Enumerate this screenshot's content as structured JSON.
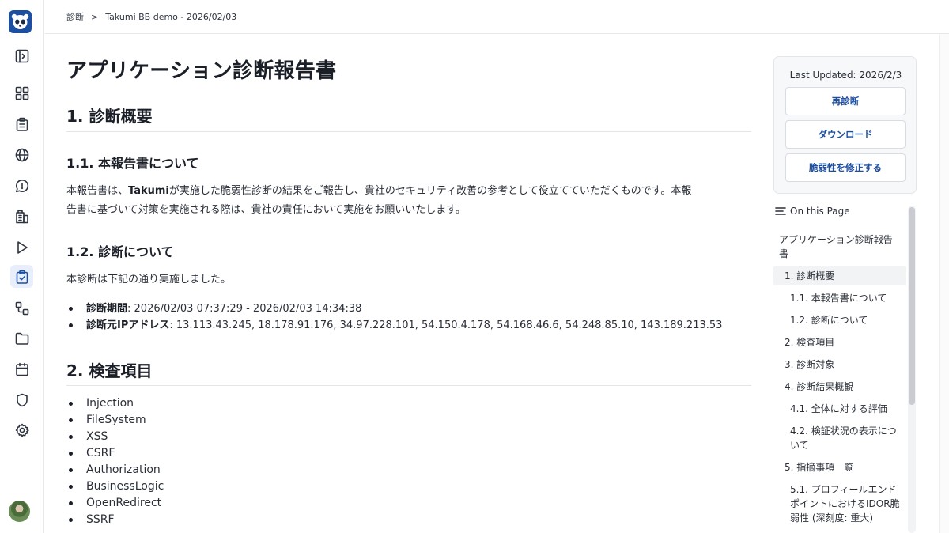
{
  "breadcrumb": {
    "root": "診断",
    "separator": ">",
    "current": "Takumi BB demo - 2026/02/03"
  },
  "sidebar": {
    "icons": [
      "logo-icon",
      "sidebar-toggle-icon",
      "dashboard-icon",
      "clipboard-list-icon",
      "globe-icon",
      "chat-icon",
      "building-icon",
      "play-icon",
      "clipboard-check-icon",
      "workflow-icon",
      "folder-icon",
      "calendar-icon",
      "shield-icon",
      "gear-icon"
    ],
    "active": "clipboard-check-icon"
  },
  "report": {
    "title": "アプリケーション診断報告書",
    "s1": "1. 診断概要",
    "s1_1": "1.1. 本報告書について",
    "s1_1_text_pre": "本報告書は、",
    "s1_1_text_bold": "Takumi",
    "s1_1_text_line1": "が実施した脆弱性診断の結果をご報告し、貴社のセキュリティ改善の参考として役立てていただくものです。本報",
    "s1_1_text_line2": "告書に基づいて対策を実施される際は、貴社の責任において実施をお願いいたします。",
    "s1_2": "1.2. 診断について",
    "s1_2_text": "本診断は下記の通り実施しました。",
    "period_label": "診断期間",
    "period_value": ": 2026/02/03 07:37:29 - 2026/02/03 14:34:38",
    "ip_label": "診断元IPアドレス",
    "ip_value": ": 13.113.43.245, 18.178.91.176, 34.97.228.101, 54.150.4.178, 54.168.46.6, 54.248.85.10, 143.189.213.53",
    "s2": "2. 検査項目",
    "checks": [
      "Injection",
      "FileSystem",
      "XSS",
      "CSRF",
      "Authorization",
      "BusinessLogic",
      "OpenRedirect",
      "SSRF"
    ]
  },
  "actions": {
    "last_updated": "Last Updated: 2026/2/3",
    "rediagnose": "再診断",
    "download": "ダウンロード",
    "fix": "脆弱性を修正する"
  },
  "toc": {
    "heading": "On this Page",
    "items": [
      "アプリケーション診断報告",
      "書",
      "1. 診断概要",
      "1.1. 本報告書について",
      "1.2. 診断について",
      "2. 検査項目",
      "3. 診断対象",
      "4. 診断結果概観",
      "4.1. 全体に対する評価",
      "4.2. 検証状況の表示につ",
      "いて",
      "5. 指摘事項一覧",
      "5.1. プロフィールエンド",
      "ポイントにおけるIDOR脆",
      "弱性 (深刻度: 重大)"
    ]
  }
}
